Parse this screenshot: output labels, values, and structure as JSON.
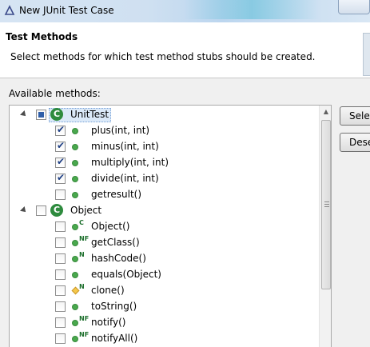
{
  "window": {
    "title": "New JUnit Test Case"
  },
  "header": {
    "title": "Test Methods",
    "description": "Select methods for which test method stubs should be created."
  },
  "available_label": "Available methods:",
  "buttons": {
    "select_all": "Sele",
    "deselect_all": "Dese"
  },
  "tree": {
    "classes": [
      {
        "name": "UnitTest",
        "icon_letter": "C",
        "checked": "partial",
        "expanded": true,
        "selected": true,
        "methods": [
          {
            "label": "plus(int, int)",
            "checked": true,
            "icon": "public-method-icon",
            "badge": ""
          },
          {
            "label": "minus(int, int)",
            "checked": true,
            "icon": "public-method-icon",
            "badge": ""
          },
          {
            "label": "multiply(int, int)",
            "checked": true,
            "icon": "public-method-icon",
            "badge": ""
          },
          {
            "label": "divide(int, int)",
            "checked": true,
            "icon": "public-method-icon",
            "badge": ""
          },
          {
            "label": "getresult()",
            "checked": false,
            "icon": "public-method-icon",
            "badge": ""
          }
        ]
      },
      {
        "name": "Object",
        "icon_letter": "C",
        "checked": false,
        "expanded": true,
        "selected": false,
        "methods": [
          {
            "label": "Object()",
            "checked": false,
            "icon": "constructor-icon",
            "badge": "C"
          },
          {
            "label": "getClass()",
            "checked": false,
            "icon": "native-final-method-icon",
            "badge": "NF"
          },
          {
            "label": "hashCode()",
            "checked": false,
            "icon": "native-method-icon",
            "badge": "N"
          },
          {
            "label": "equals(Object)",
            "checked": false,
            "icon": "public-method-icon",
            "badge": ""
          },
          {
            "label": "clone()",
            "checked": false,
            "icon": "protected-native-method-icon",
            "badge": "N"
          },
          {
            "label": "toString()",
            "checked": false,
            "icon": "public-method-icon",
            "badge": ""
          },
          {
            "label": "notify()",
            "checked": false,
            "icon": "native-final-method-icon",
            "badge": "NF"
          },
          {
            "label": "notifyAll()",
            "checked": false,
            "icon": "native-final-method-icon",
            "badge": "NF"
          }
        ]
      }
    ]
  },
  "colors": {
    "accent": "#2e8b3e",
    "method": "#49a84d",
    "protected": "#f5c84a",
    "check": "#1e3f85"
  }
}
